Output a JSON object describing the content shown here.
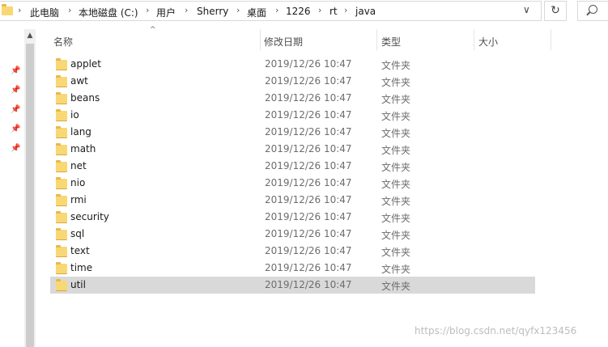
{
  "address_bar": {
    "crumbs": [
      "此电脑",
      "本地磁盘 (C:)",
      "用户",
      "Sherry",
      "桌面",
      "1226",
      "rt",
      "java"
    ],
    "separator": "›",
    "dropdown": "∨",
    "refresh": "↻"
  },
  "columns": {
    "name": "名称",
    "date": "修改日期",
    "type": "类型",
    "size": "大小",
    "sort_indicator": "^"
  },
  "files": [
    {
      "name": "applet",
      "date": "2019/12/26 10:47",
      "type": "文件夹"
    },
    {
      "name": "awt",
      "date": "2019/12/26 10:47",
      "type": "文件夹"
    },
    {
      "name": "beans",
      "date": "2019/12/26 10:47",
      "type": "文件夹"
    },
    {
      "name": "io",
      "date": "2019/12/26 10:47",
      "type": "文件夹"
    },
    {
      "name": "lang",
      "date": "2019/12/26 10:47",
      "type": "文件夹"
    },
    {
      "name": "math",
      "date": "2019/12/26 10:47",
      "type": "文件夹"
    },
    {
      "name": "net",
      "date": "2019/12/26 10:47",
      "type": "文件夹"
    },
    {
      "name": "nio",
      "date": "2019/12/26 10:47",
      "type": "文件夹"
    },
    {
      "name": "rmi",
      "date": "2019/12/26 10:47",
      "type": "文件夹"
    },
    {
      "name": "security",
      "date": "2019/12/26 10:47",
      "type": "文件夹"
    },
    {
      "name": "sql",
      "date": "2019/12/26 10:47",
      "type": "文件夹"
    },
    {
      "name": "text",
      "date": "2019/12/26 10:47",
      "type": "文件夹"
    },
    {
      "name": "time",
      "date": "2019/12/26 10:47",
      "type": "文件夹"
    },
    {
      "name": "util",
      "date": "2019/12/26 10:47",
      "type": "文件夹"
    }
  ],
  "selected_file": "util",
  "watermark": "https://blog.csdn.net/qyfx123456",
  "icons": {
    "folder": "folder-icon",
    "pin": "pin-icon",
    "search": "search-icon",
    "refresh": "refresh-icon"
  },
  "colors": {
    "folder": "#f8d775",
    "selection": "#d9d9d9",
    "scrollbar": "#cdcdcd"
  }
}
